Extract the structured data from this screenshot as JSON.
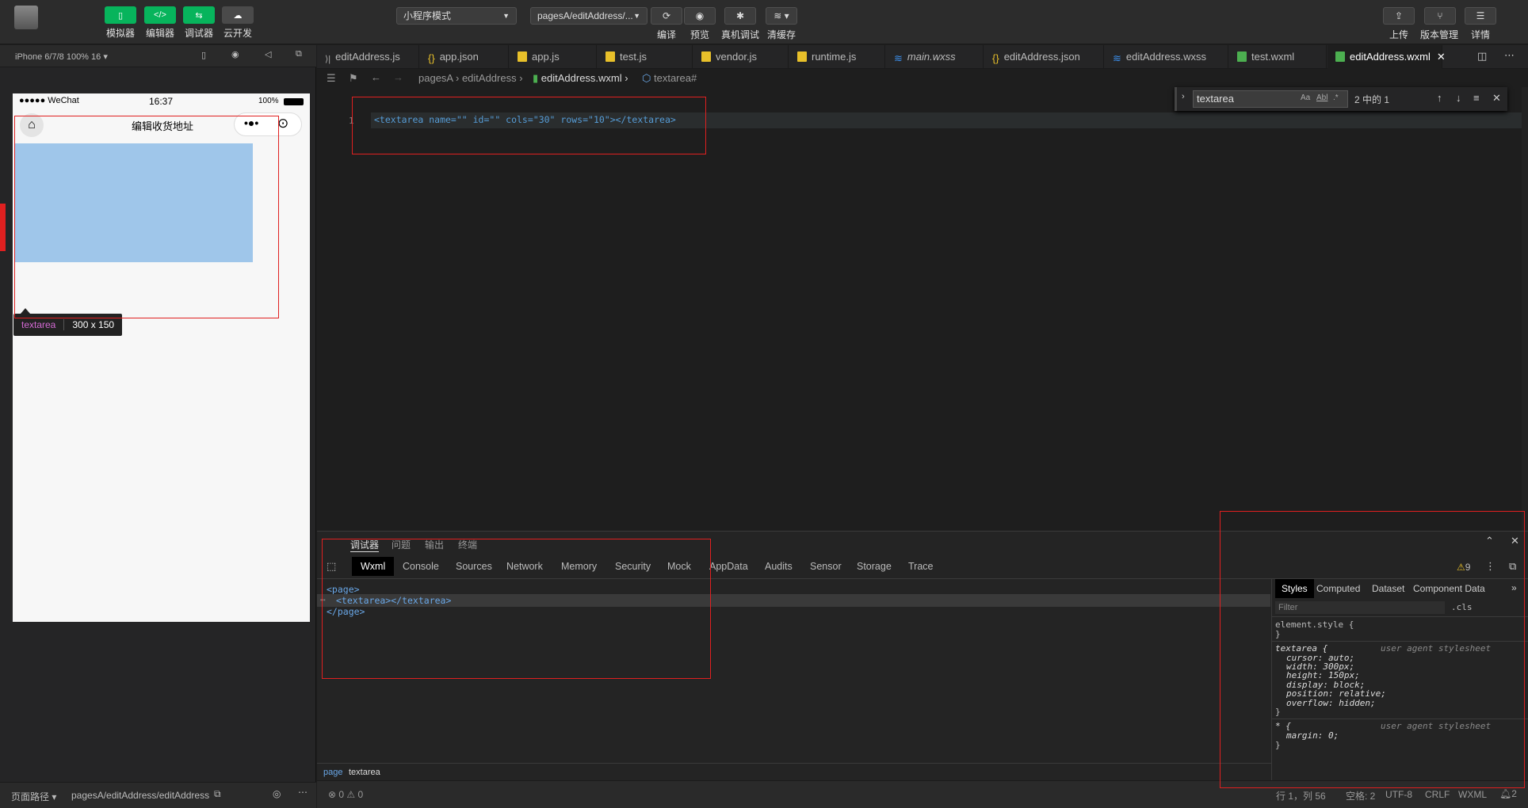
{
  "toolbar": {
    "left_buttons": [
      {
        "label": "模拟器",
        "icon": "phone-icon"
      },
      {
        "label": "编辑器",
        "icon": "code-icon"
      },
      {
        "label": "调试器",
        "icon": "debug-icon"
      },
      {
        "label": "云开发",
        "icon": "cloud-icon"
      }
    ],
    "mode_select": "小程序模式",
    "page_select": "pagesA/editAddress/...",
    "mid_buttons": [
      {
        "label": "编译",
        "icon": "refresh-icon"
      },
      {
        "label": "预览",
        "icon": "eye-icon"
      },
      {
        "label": "真机调试",
        "icon": "bug-icon"
      },
      {
        "label": "清缓存",
        "icon": "layers-icon"
      }
    ],
    "right_buttons": [
      {
        "label": "上传",
        "icon": "upload-icon"
      },
      {
        "label": "版本管理",
        "icon": "branch-icon"
      },
      {
        "label": "详情",
        "icon": "menu-icon"
      }
    ]
  },
  "simulator": {
    "device": "iPhone 6/7/8 100% 16",
    "status": {
      "carrier": "●●●●● WeChat",
      "time": "16:37",
      "battery": "100%"
    },
    "nav_title": "编辑收货地址",
    "tooltip": {
      "tag": "textarea",
      "size": "300 x 150"
    },
    "footer_label": "页面路径",
    "footer_path": "pagesA/editAddress/editAddress"
  },
  "editor": {
    "tabs": [
      {
        "label": "editAddress.js",
        "icon": "js-file-icon"
      },
      {
        "label": "app.json",
        "icon": "json-file-icon"
      },
      {
        "label": "app.js",
        "icon": "js-file-icon"
      },
      {
        "label": "test.js",
        "icon": "js-file-icon"
      },
      {
        "label": "vendor.js",
        "icon": "js-file-icon"
      },
      {
        "label": "runtime.js",
        "icon": "js-file-icon"
      },
      {
        "label": "main.wxss",
        "icon": "wxss-file-icon"
      },
      {
        "label": "editAddress.json",
        "icon": "json-file-icon"
      },
      {
        "label": "editAddress.wxss",
        "icon": "wxss-file-icon"
      },
      {
        "label": "test.wxml",
        "icon": "wxml-file-icon"
      },
      {
        "label": "editAddress.wxml",
        "icon": "wxml-file-icon"
      }
    ],
    "breadcrumb": [
      "pagesA",
      "editAddress",
      "editAddress.wxml",
      "textarea#"
    ],
    "code": "<textarea name=\"\" id=\"\" cols=\"30\" rows=\"10\"></textarea>",
    "line_number": "1",
    "find": {
      "query": "textarea",
      "result": "2 中的 1",
      "options": [
        "Aa",
        "Abl",
        ".*"
      ]
    }
  },
  "debugger": {
    "top_tabs": [
      "调试器",
      "问题",
      "输出",
      "终端"
    ],
    "tabs": [
      "Wxml",
      "Console",
      "Sources",
      "Network",
      "Memory",
      "Security",
      "Mock",
      "AppData",
      "Audits",
      "Sensor",
      "Storage",
      "Trace"
    ],
    "warning_count": "9",
    "tree": [
      "<page>",
      "<textarea></textarea>",
      "</page>"
    ],
    "style_tabs": [
      "Styles",
      "Computed",
      "Dataset",
      "Component Data"
    ],
    "filter_placeholder": "Filter",
    "cls": ".cls",
    "element_style": "element.style {",
    "element_style_close": "}",
    "rule1": {
      "selector": "textarea {",
      "source": "user agent stylesheet",
      "props": [
        "cursor: auto;",
        "width: 300px;",
        "height: 150px;",
        "display: block;",
        "position: relative;",
        "overflow: hidden;"
      ],
      "close": "}"
    },
    "rule2": {
      "selector": "* {",
      "source": "user agent stylesheet",
      "props": [
        "margin: 0;"
      ],
      "close": "}"
    },
    "bottom_crumbs": [
      "page",
      "textarea"
    ]
  },
  "statusbar": {
    "errors": "⊗ 0 ⚠ 0",
    "position": "行 1，列 56",
    "spaces": "空格: 2",
    "encoding": "UTF-8",
    "eol": "CRLF",
    "lang": "WXML",
    "notifications": "2"
  },
  "colors": {
    "green": "#07b45c",
    "accent_red": "#e02020",
    "selection": "#9fc6ea"
  }
}
